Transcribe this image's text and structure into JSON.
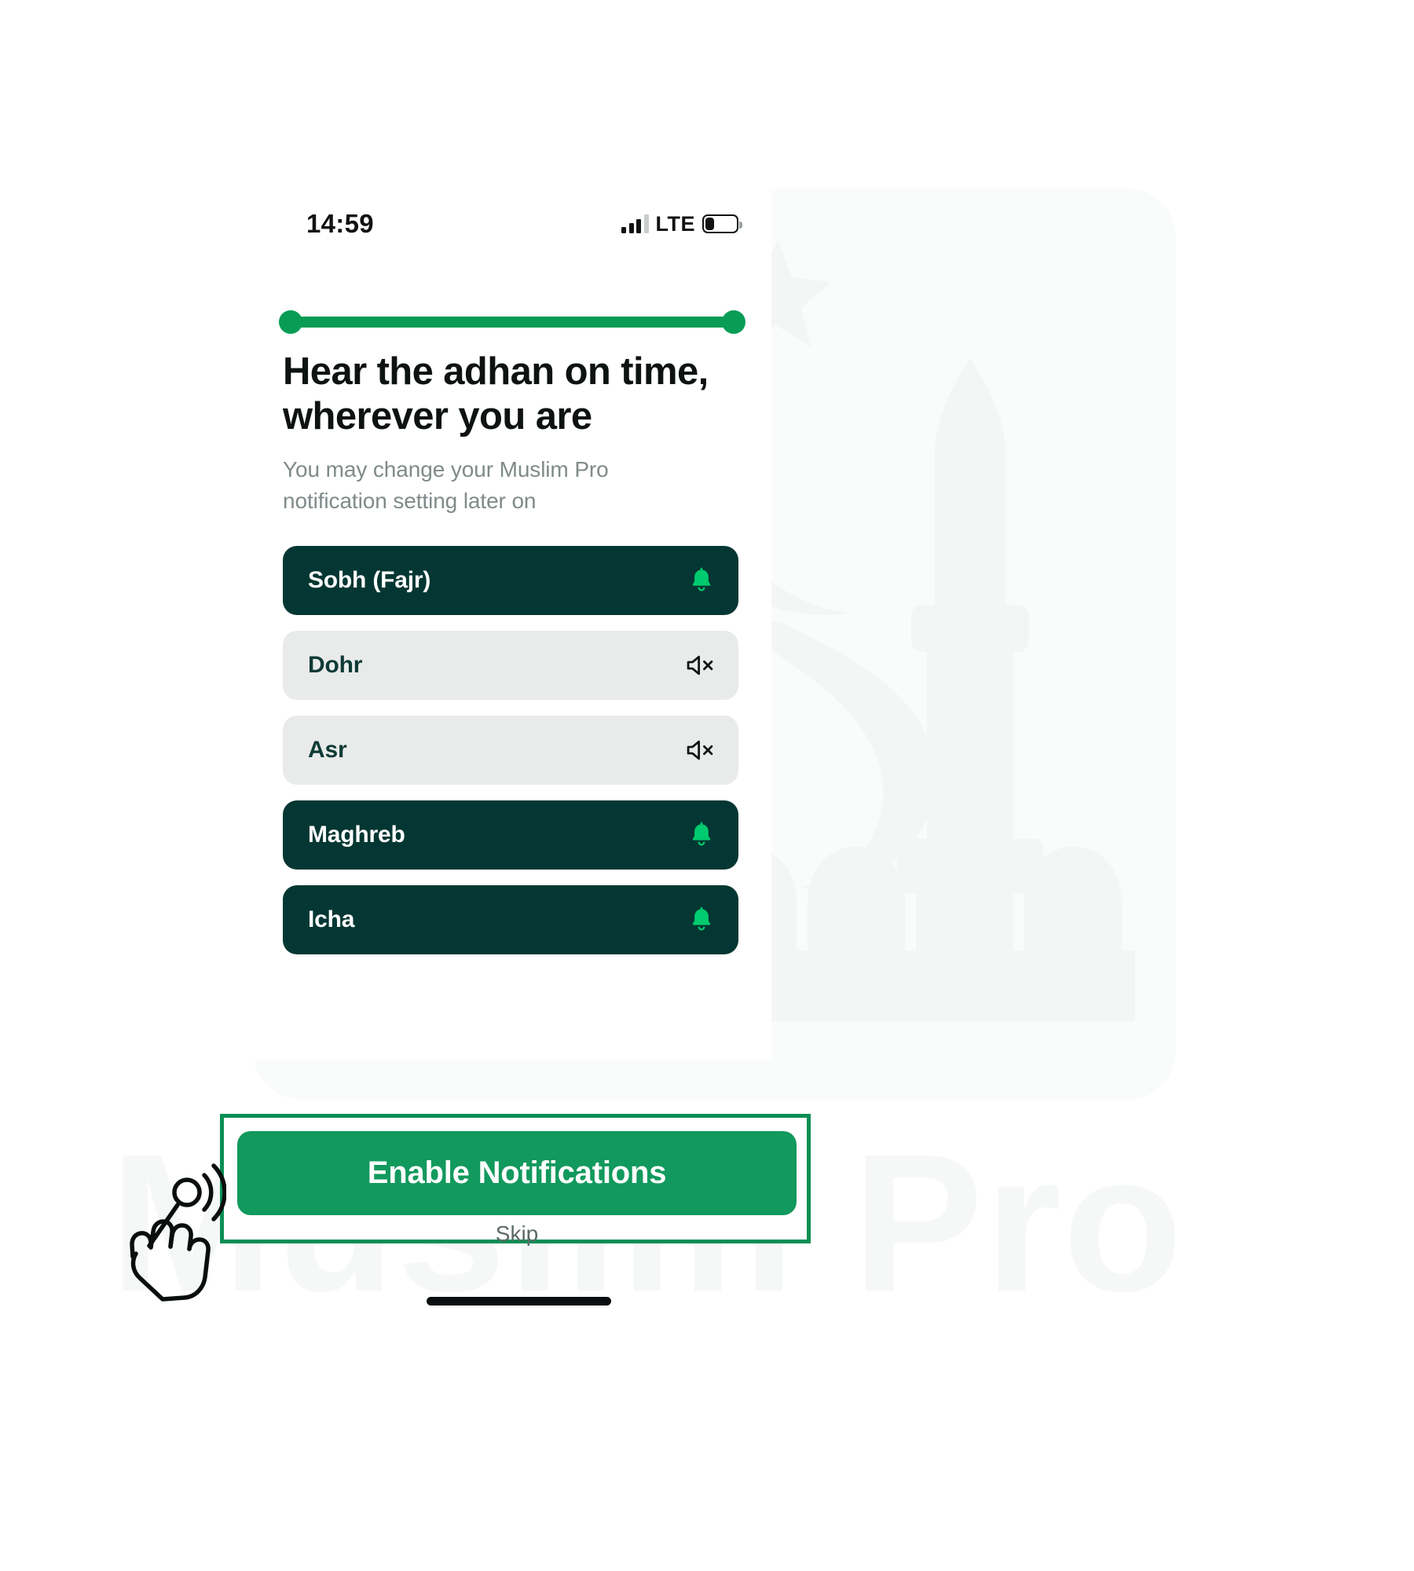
{
  "status_bar": {
    "time": "14:59",
    "network_label": "LTE",
    "signal_bars_total": 4,
    "signal_bars_active": 3,
    "battery_percent": 28,
    "signal_icon": "signal-bars-icon",
    "battery_icon": "battery-icon"
  },
  "progress": {
    "percent": 100
  },
  "screen": {
    "headline": "Hear the adhan on time, wherever you are",
    "subhead": "You may change your Muslim Pro notification setting later on"
  },
  "prayers": [
    {
      "name": "Sobh (Fajr)",
      "enabled": true,
      "icon": "bell-icon"
    },
    {
      "name": "Dohr",
      "enabled": false,
      "icon": "speaker-muted-icon"
    },
    {
      "name": "Asr",
      "enabled": false,
      "icon": "speaker-muted-icon"
    },
    {
      "name": "Maghreb",
      "enabled": true,
      "icon": "bell-icon"
    },
    {
      "name": "Icha",
      "enabled": true,
      "icon": "bell-icon"
    }
  ],
  "cta": {
    "primary_label": "Enable Notifications",
    "secondary_label": "Skip"
  },
  "background": {
    "watermark_text": "Muslim Pro",
    "mosque_icon": "mosque-watermark-icon"
  },
  "colors": {
    "brand_green": "#12995d",
    "highlight_green": "#0b8f54",
    "progress_green": "#089c54",
    "row_on_bg": "#043733",
    "row_off_bg": "#e9eaea",
    "bell_green": "#00cb6e",
    "text_dark": "#0e1312",
    "text_muted": "#7f8b8a",
    "watermark_gray": "#f6f7f7"
  }
}
